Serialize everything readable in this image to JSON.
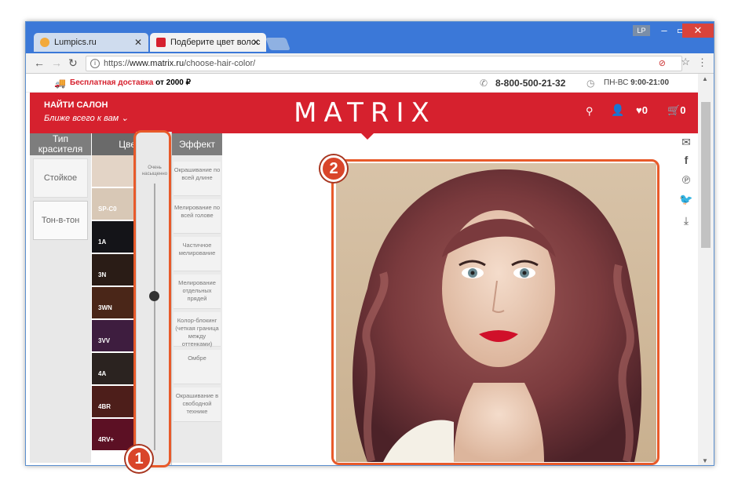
{
  "browser": {
    "tabs": [
      {
        "label": "Lumpics.ru",
        "favicon_color": "#f2a93b"
      },
      {
        "label": "Подберите цвет волос",
        "favicon_color": "#d6212e"
      }
    ],
    "user_badge": "LP",
    "url_prefix": "https://",
    "url_host": "www.matrix.ru",
    "url_path": "/choose-hair-color/"
  },
  "site": {
    "delivery_red": "Бесплатная доставка",
    "delivery_rest": " от 2000 ₽",
    "phone": "8-800-500-21-32",
    "hours_days": "ПН-ВС ",
    "hours_time": "9:00-21:00",
    "salon_title": "НАЙТИ САЛОН",
    "salon_sub": "Ближе всего к вам",
    "logo": "MATRIX",
    "wishlist_count": "0",
    "cart_count": "0",
    "accent_color": "#d6212e"
  },
  "picker": {
    "type_header": "Тип красителя",
    "color_header": "Цве",
    "effect_header": "Эффект",
    "types": [
      "Стойкое",
      "Тон-в-тон"
    ],
    "slider_label": "Очень насыщенно",
    "slider_value": 0.42,
    "swatches": [
      {
        "code": "",
        "color": "#e3d4c6"
      },
      {
        "code": "SP-C0",
        "color": "#d8c8b6"
      },
      {
        "code": "1A",
        "color": "#141418"
      },
      {
        "code": "3N",
        "color": "#2a1c16"
      },
      {
        "code": "3WN",
        "color": "#4a2618"
      },
      {
        "code": "3VV",
        "color": "#3e1d3f"
      },
      {
        "code": "4A",
        "color": "#2b2320"
      },
      {
        "code": "4BR",
        "color": "#4d1e1a"
      },
      {
        "code": "4RV+",
        "color": "#5c1024"
      }
    ],
    "effects": [
      "Окрашивание по всей длине",
      "Мелирование по всей голове",
      "Частичное мелирование",
      "Мелирование отдельных прядей",
      "Колор-блокинг (четкая граница между оттенками)",
      "Омбре",
      "Окрашивание в свободной технике"
    ]
  },
  "callouts": [
    "1",
    "2"
  ]
}
